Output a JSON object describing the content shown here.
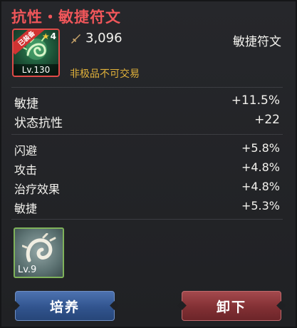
{
  "title": "抗性・敏捷符文",
  "rune": {
    "badge": "已装备",
    "stars": "4",
    "level": "Lv.130",
    "power": "3,096",
    "type": "敏捷符文",
    "trade_note": "非极品不可交易"
  },
  "main_stats": [
    {
      "label": "敏捷",
      "value": "+11.5%"
    },
    {
      "label": "状态抗性",
      "value": "+22"
    }
  ],
  "sub_stats": [
    {
      "label": "闪避",
      "value": "+5.8%"
    },
    {
      "label": "攻击",
      "value": "+4.8%"
    },
    {
      "label": "治疗效果",
      "value": "+4.8%"
    },
    {
      "label": "敏捷",
      "value": "+5.3%"
    }
  ],
  "sub_rune": {
    "level": "Lv.9"
  },
  "buttons": {
    "cultivate": "培养",
    "unequip": "卸下"
  },
  "colors": {
    "title": "#f0565a",
    "trade_note": "#e0b13a",
    "blue_button": "#31548e",
    "red_button": "#823034"
  },
  "icons": {
    "power": "sword-icon",
    "star": "star-icon"
  }
}
